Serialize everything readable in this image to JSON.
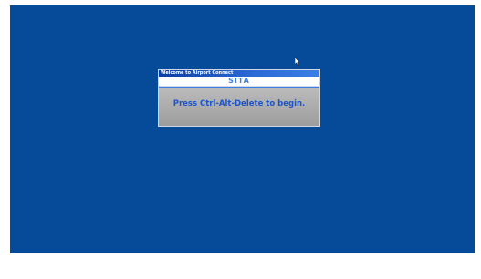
{
  "dialog": {
    "title": "Welcome to Airport Connect",
    "logo_text": "SITA",
    "message": "Press Ctrl-Alt-Delete to begin."
  },
  "desktop": {
    "background_color": "#064b9a"
  },
  "icons": {
    "cursor": "mouse-pointer-icon"
  }
}
